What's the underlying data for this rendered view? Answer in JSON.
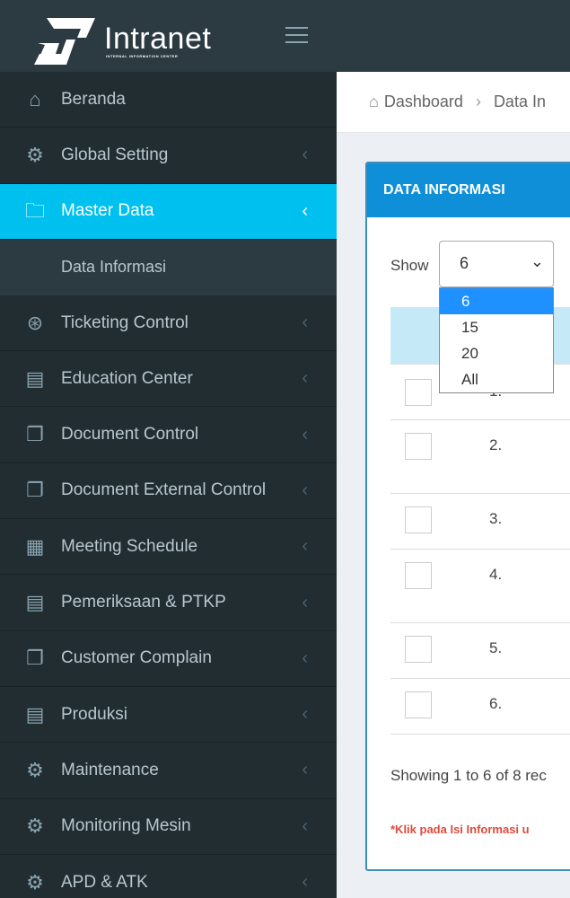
{
  "brand": {
    "name": "Intranet",
    "tagline": "INTERNAL INFORMATION CENTER"
  },
  "sidebar": {
    "items": [
      {
        "label": "Beranda",
        "icon": "home-icon"
      },
      {
        "label": "Global Setting",
        "icon": "gear-icon"
      },
      {
        "label": "Master Data",
        "icon": "folder-icon",
        "active": true
      },
      {
        "label": "Ticketing Control",
        "icon": "lifebuoy-icon"
      },
      {
        "label": "Education Center",
        "icon": "book-icon"
      },
      {
        "label": "Document Control",
        "icon": "documents-icon"
      },
      {
        "label": "Document External Control",
        "icon": "documents-icon"
      },
      {
        "label": "Meeting Schedule",
        "icon": "calendar-icon"
      },
      {
        "label": "Pemeriksaan & PTKP",
        "icon": "book-icon"
      },
      {
        "label": "Customer Complain",
        "icon": "documents-icon"
      },
      {
        "label": "Produksi",
        "icon": "book-icon"
      },
      {
        "label": "Maintenance",
        "icon": "gear-icon"
      },
      {
        "label": "Monitoring Mesin",
        "icon": "gear-icon"
      },
      {
        "label": "APD & ATK",
        "icon": "gear-icon"
      }
    ],
    "subitem": "Data Informasi"
  },
  "breadcrumb": {
    "home": "Dashboard",
    "current": "Data In"
  },
  "box": {
    "title": "DATA INFORMASI",
    "show_label": "Show",
    "page_size": "6",
    "page_size_options": [
      "6",
      "15",
      "20",
      "All"
    ],
    "rows": [
      "1.",
      "2.",
      "3.",
      "4.",
      "5.",
      "6."
    ],
    "showing_text": "Showing 1 to 6 of 8 rec",
    "note": "*Klik pada Isi Informasi u"
  },
  "colors": {
    "accent": "#00c0ef",
    "header_blue": "#0e8fd8",
    "sidebar_bg": "#222d32",
    "note_red": "#dd4b39"
  }
}
